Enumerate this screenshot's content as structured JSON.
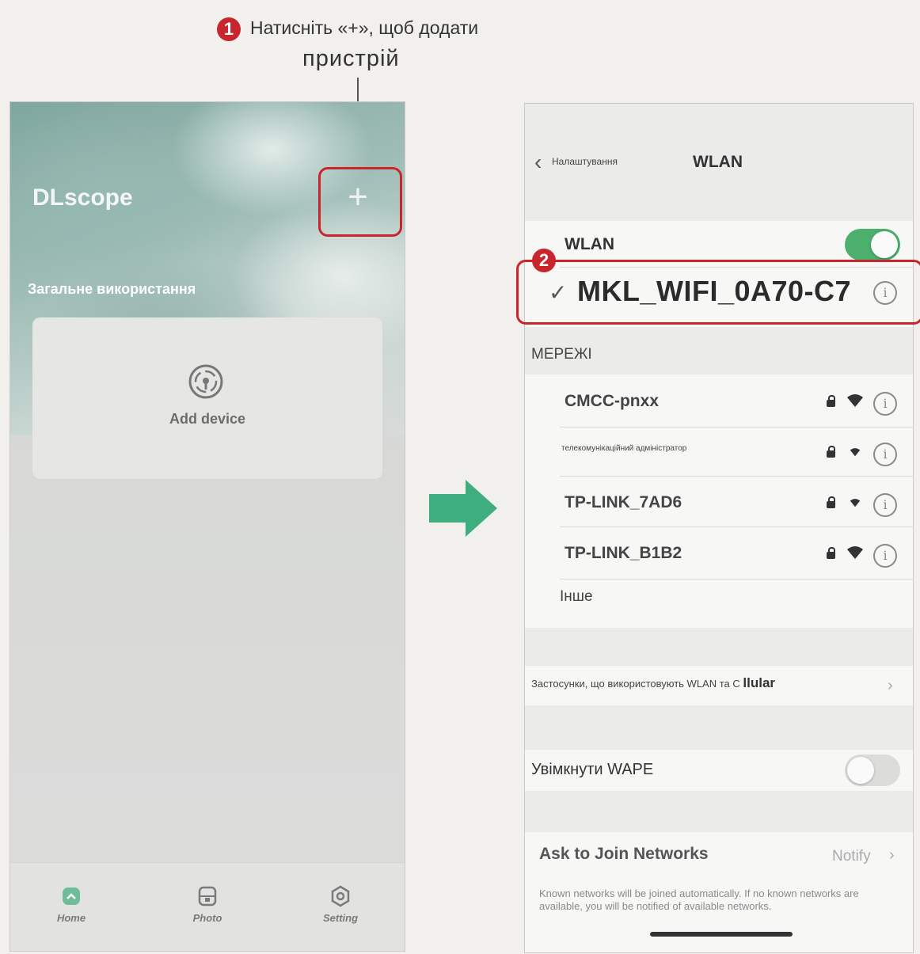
{
  "instructions": {
    "step1_number": "1",
    "step1_text_line1": "Натисніть «+», щоб додати",
    "step1_text_line2": "пристрій",
    "step2_number": "2"
  },
  "app": {
    "title": "DLscope",
    "add_button_symbol": "+",
    "section_label": "Загальне використання",
    "add_device_label": "Add device",
    "tabs": [
      {
        "label": "Home",
        "icon": "home-icon"
      },
      {
        "label": "Photo",
        "icon": "photo-icon"
      },
      {
        "label": "Setting",
        "icon": "settings-icon"
      }
    ]
  },
  "wlan": {
    "back_label": "Налаштування",
    "title": "WLAN",
    "toggle_label": "WLAN",
    "toggle_on": true,
    "connected_network": "MKL_WIFI_0A70-C7",
    "networks_header": "МЕРЕЖІ",
    "networks": [
      {
        "name": "CMCC-pnxx",
        "small": false
      },
      {
        "name": "телекомунікаційний адміністратор",
        "small": true
      },
      {
        "name": "TP-LINK_7AD6",
        "small": false
      },
      {
        "name": "TP-LINK_B1B2",
        "small": false
      }
    ],
    "other_label": "Інше",
    "apps_label": "Застосунки, що використовують WLAN та C",
    "apps_label_tail": "llular",
    "wape_label": "Увімкнути WAPE",
    "wape_on": false,
    "ask_label": "Ask to Join Networks",
    "ask_value": "Notify",
    "ask_description": "Known networks will be joined automatically. If no known networks are available, you will be notified of available networks."
  },
  "colors": {
    "highlight": "#c8262c",
    "toggle_on": "#4caf6e",
    "arrow": "#3fae7f"
  }
}
